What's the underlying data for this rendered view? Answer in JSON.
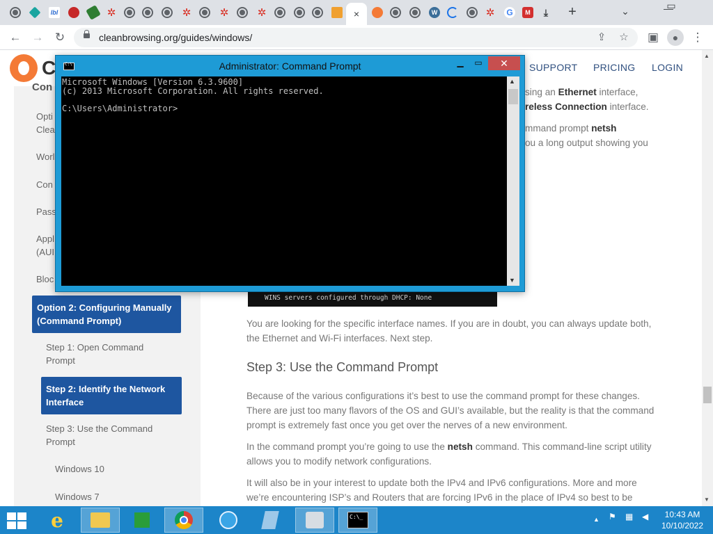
{
  "browser": {
    "tab_close": "×",
    "new_tab": "+",
    "url": "cleanbrowsing.org/guides/windows/",
    "back_icon": "←",
    "forward_icon": "→",
    "reload_icon": "↻",
    "share_icon": "⇪",
    "star_icon": "☆",
    "sidebar_icon": "▣",
    "profile_icon": "●",
    "menu_icon": "⋮",
    "min_icon": "⌄",
    "max_icon": "▭",
    "winmin_icon": "—"
  },
  "site": {
    "logo_text": "C",
    "nav": [
      "SUPPORT",
      "PRICING",
      "LOGIN"
    ]
  },
  "sidebar": {
    "cut_heading": "Con",
    "items": [
      "Opti\nClea",
      "Worl",
      "Con",
      "Pass",
      "Appl\n(AUI",
      "Bloc"
    ],
    "option2": "Option 2: Configuring Manually\n(Command Prompt)",
    "step1": "Step 1: Open Command\nPrompt",
    "step2": "Step 2: Identify the Network\nInterface",
    "step3": "Step 3: Use the Command\nPrompt",
    "win10": "Windows 10",
    "win7": "Windows 7"
  },
  "content": {
    "p1_a": "sing an ",
    "p1_b": "Ethernet",
    "p1_c": " interface,",
    "p2_a": "reless Connection",
    "p2_b": " interface.",
    "p3_a": "mmand prompt ",
    "p3_b": "netsh",
    "p4": "ou a long output showing you",
    "code_line": "WINS servers configured through DHCP: None",
    "p5": "You are looking for the specific interface names. If you are in doubt, you can always update both, the Ethernet and Wi-Fi interfaces. Next step.",
    "h_step3": "Step 3: Use the Command Prompt",
    "p6": "Because of the various configurations it’s best to use the command prompt for these changes. There are just too many flavors of the OS and GUI’s available, but the reality is that the command prompt is extremely fast once you get over the nerves of a new environment.",
    "p7_a": "In the command prompt you’re going to use the ",
    "p7_b": "netsh",
    "p7_c": " command. This command-line script utility allows you to modify network configurations.",
    "p8": "It will also be in your interest to update both the IPv4 and IPv6 configurations. More and more we’re encountering ISP’s and Routers that are forcing IPv6 in the place of IPv4 so best to be"
  },
  "cmd": {
    "title": "Administrator: Command Prompt",
    "min": "▁",
    "max": "▭",
    "close": "✕",
    "lines": [
      "Microsoft Windows [Version 6.3.9600]",
      "(c) 2013 Microsoft Corporation. All rights reserved.",
      "",
      "C:\\Users\\Administrator>"
    ]
  },
  "taskbar": {
    "ie_glyph": "e",
    "cmd_glyph": "C:\\_",
    "tray_up": "▲",
    "time": "10:43 AM",
    "date": "10/10/2022"
  },
  "colors": {
    "accent": "#1e56a0",
    "cmd_frame": "#1e9bd6",
    "taskbar": "#1c85c9",
    "logo_orange": "#f47a36"
  }
}
